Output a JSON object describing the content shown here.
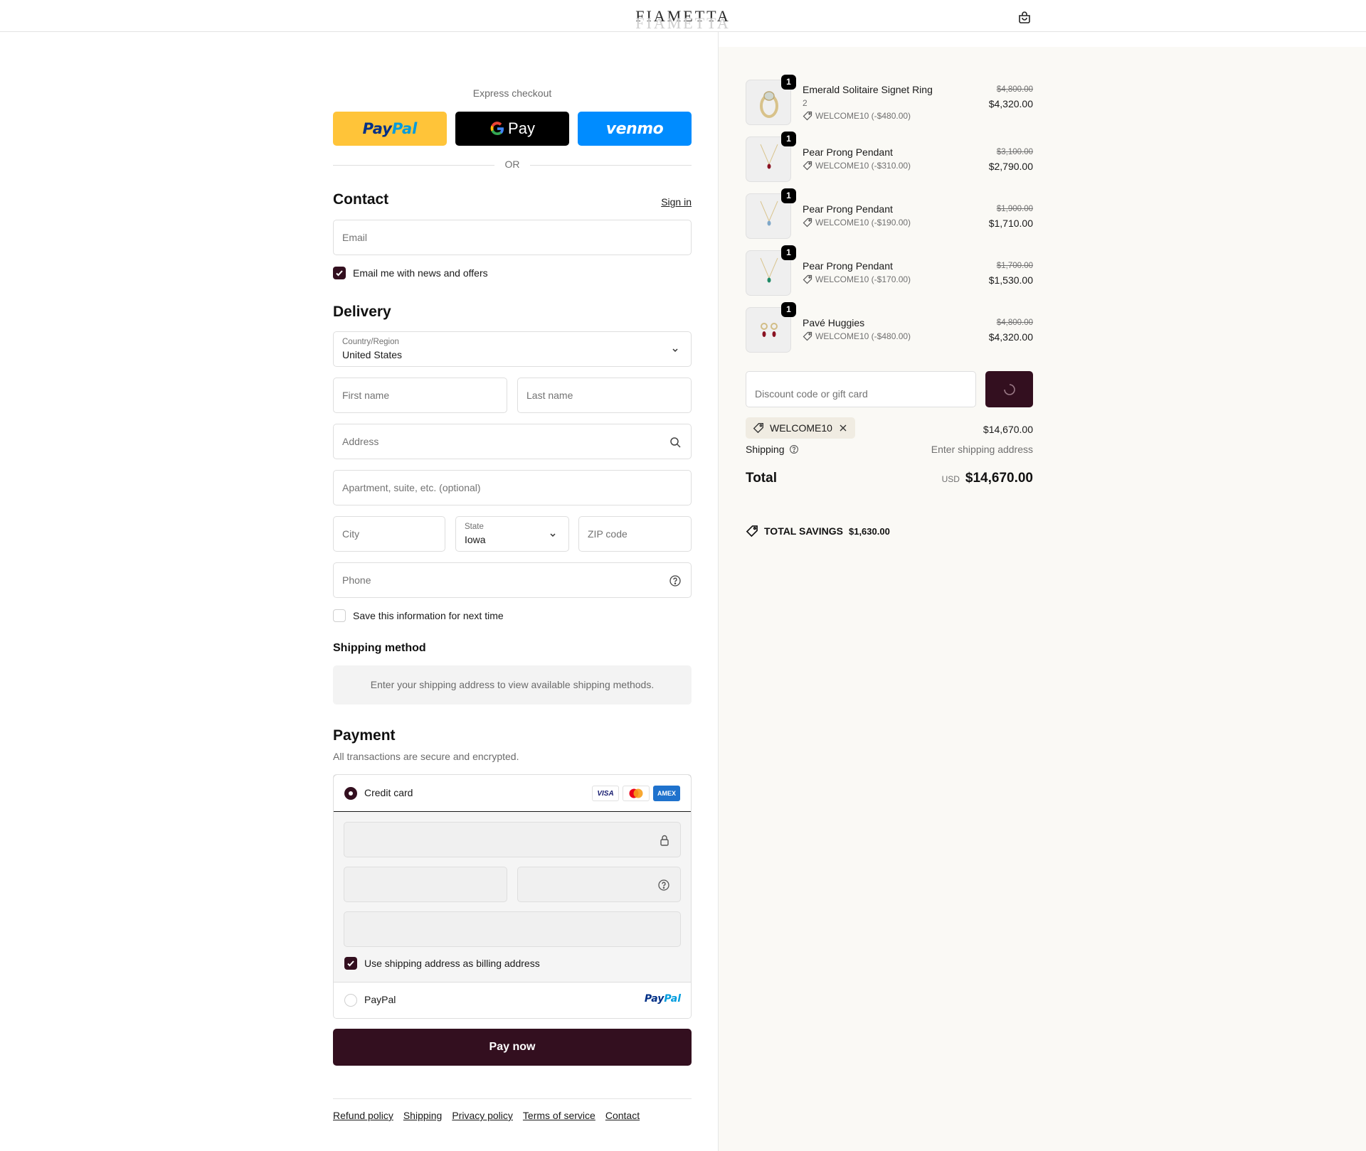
{
  "header": {
    "brand": "FIAMETTA"
  },
  "express": {
    "title": "Express checkout",
    "paypal_a": "Pay",
    "paypal_b": "Pal",
    "gpay": "Pay",
    "venmo": "venmo",
    "or": "OR"
  },
  "contact": {
    "title": "Contact",
    "sign_in": "Sign in",
    "email_placeholder": "Email",
    "news_label": "Email me with news and offers",
    "news_checked": true
  },
  "delivery": {
    "title": "Delivery",
    "country_label": "Country/Region",
    "country_value": "United States",
    "first_name": "First name",
    "last_name": "Last name",
    "address": "Address",
    "apartment": "Apartment, suite, etc. (optional)",
    "city": "City",
    "state_label": "State",
    "state_value": "Iowa",
    "zip": "ZIP code",
    "phone": "Phone",
    "save_label": "Save this information for next time"
  },
  "shipping_method": {
    "title": "Shipping method",
    "message": "Enter your shipping address to view available shipping methods."
  },
  "payment": {
    "title": "Payment",
    "subtitle": "All transactions are secure and encrypted.",
    "credit_card_label": "Credit card",
    "card_logos": [
      "VISA",
      "mastercard",
      "AMEX"
    ],
    "billing_label": "Use shipping address as billing address",
    "paypal_label": "PayPal",
    "paypal_logo_a": "Pay",
    "paypal_logo_b": "Pal",
    "pay_now": "Pay now"
  },
  "footer": {
    "links": [
      "Refund policy",
      "Shipping",
      "Privacy policy",
      "Terms of service",
      "Contact"
    ]
  },
  "summary": {
    "items": [
      {
        "name": "Emerald Solitaire Signet Ring",
        "variant": "2",
        "qty": "1",
        "discount": "WELCOME10 (-$480.00)",
        "old_price": "$4,800.00",
        "price": "$4,320.00",
        "thumb": "ring"
      },
      {
        "name": "Pear Prong Pendant",
        "variant": "",
        "qty": "1",
        "discount": "WELCOME10 (-$310.00)",
        "old_price": "$3,100.00",
        "price": "$2,790.00",
        "thumb": "pendant-red"
      },
      {
        "name": "Pear Prong Pendant",
        "variant": "",
        "qty": "1",
        "discount": "WELCOME10 (-$190.00)",
        "old_price": "$1,900.00",
        "price": "$1,710.00",
        "thumb": "pendant-blue"
      },
      {
        "name": "Pear Prong Pendant",
        "variant": "",
        "qty": "1",
        "discount": "WELCOME10 (-$170.00)",
        "old_price": "$1,700.00",
        "price": "$1,530.00",
        "thumb": "pendant-green"
      },
      {
        "name": "Pavé Huggies",
        "variant": "",
        "qty": "1",
        "discount": "WELCOME10 (-$480.00)",
        "old_price": "$4,800.00",
        "price": "$4,320.00",
        "thumb": "huggies"
      }
    ],
    "discount_placeholder": "Discount code or gift card",
    "applied_code": "WELCOME10",
    "subtotal": "$14,670.00",
    "shipping_label": "Shipping",
    "shipping_value": "Enter shipping address",
    "total_label": "Total",
    "currency": "USD",
    "total": "$14,670.00",
    "savings_label": "TOTAL SAVINGS",
    "savings_value": "$1,630.00"
  },
  "colors": {
    "accent": "#330f1f",
    "summary_bg": "#faf9f5",
    "paypal": "#ffc439",
    "venmo": "#008cff"
  }
}
